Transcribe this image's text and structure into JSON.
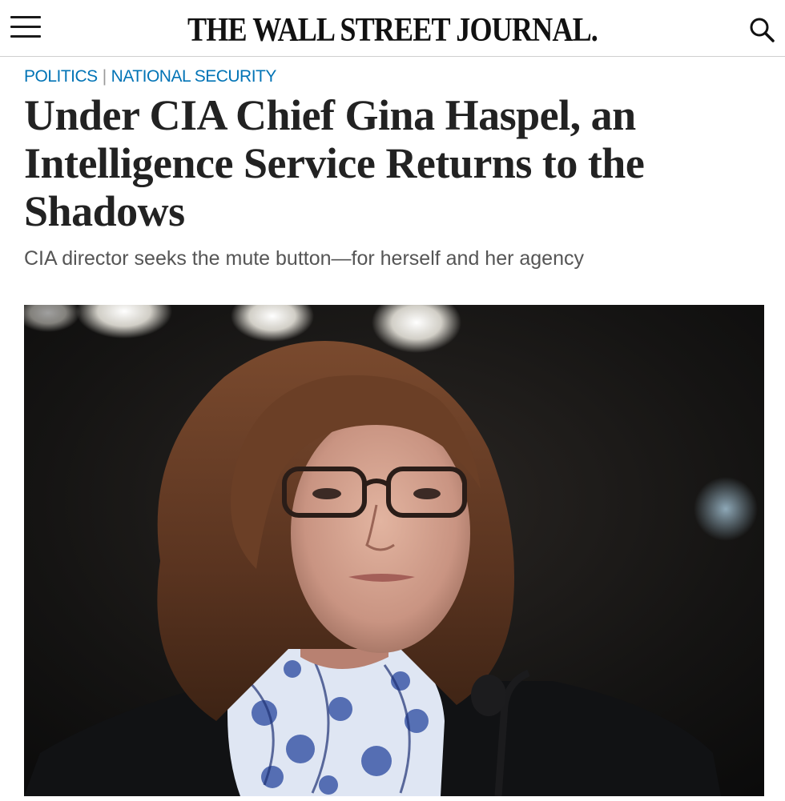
{
  "header": {
    "masthead": "THE WALL STREET JOURNAL.",
    "menu_icon": "hamburger-menu-icon",
    "search_icon": "search-icon"
  },
  "breadcrumb": {
    "section": "POLITICS",
    "separator": "|",
    "subsection": "NATIONAL SECURITY"
  },
  "article": {
    "headline": "Under CIA Chief Gina Haspel, an Intelligence Service Returns to the Shadows",
    "dek": "CIA director seeks the mute button—for herself and her agency"
  },
  "photo": {
    "subject": "portrait photo of woman with glasses at microphone"
  },
  "colors": {
    "link_blue": "#0274b6",
    "headline": "#222222",
    "dek": "#555555"
  }
}
